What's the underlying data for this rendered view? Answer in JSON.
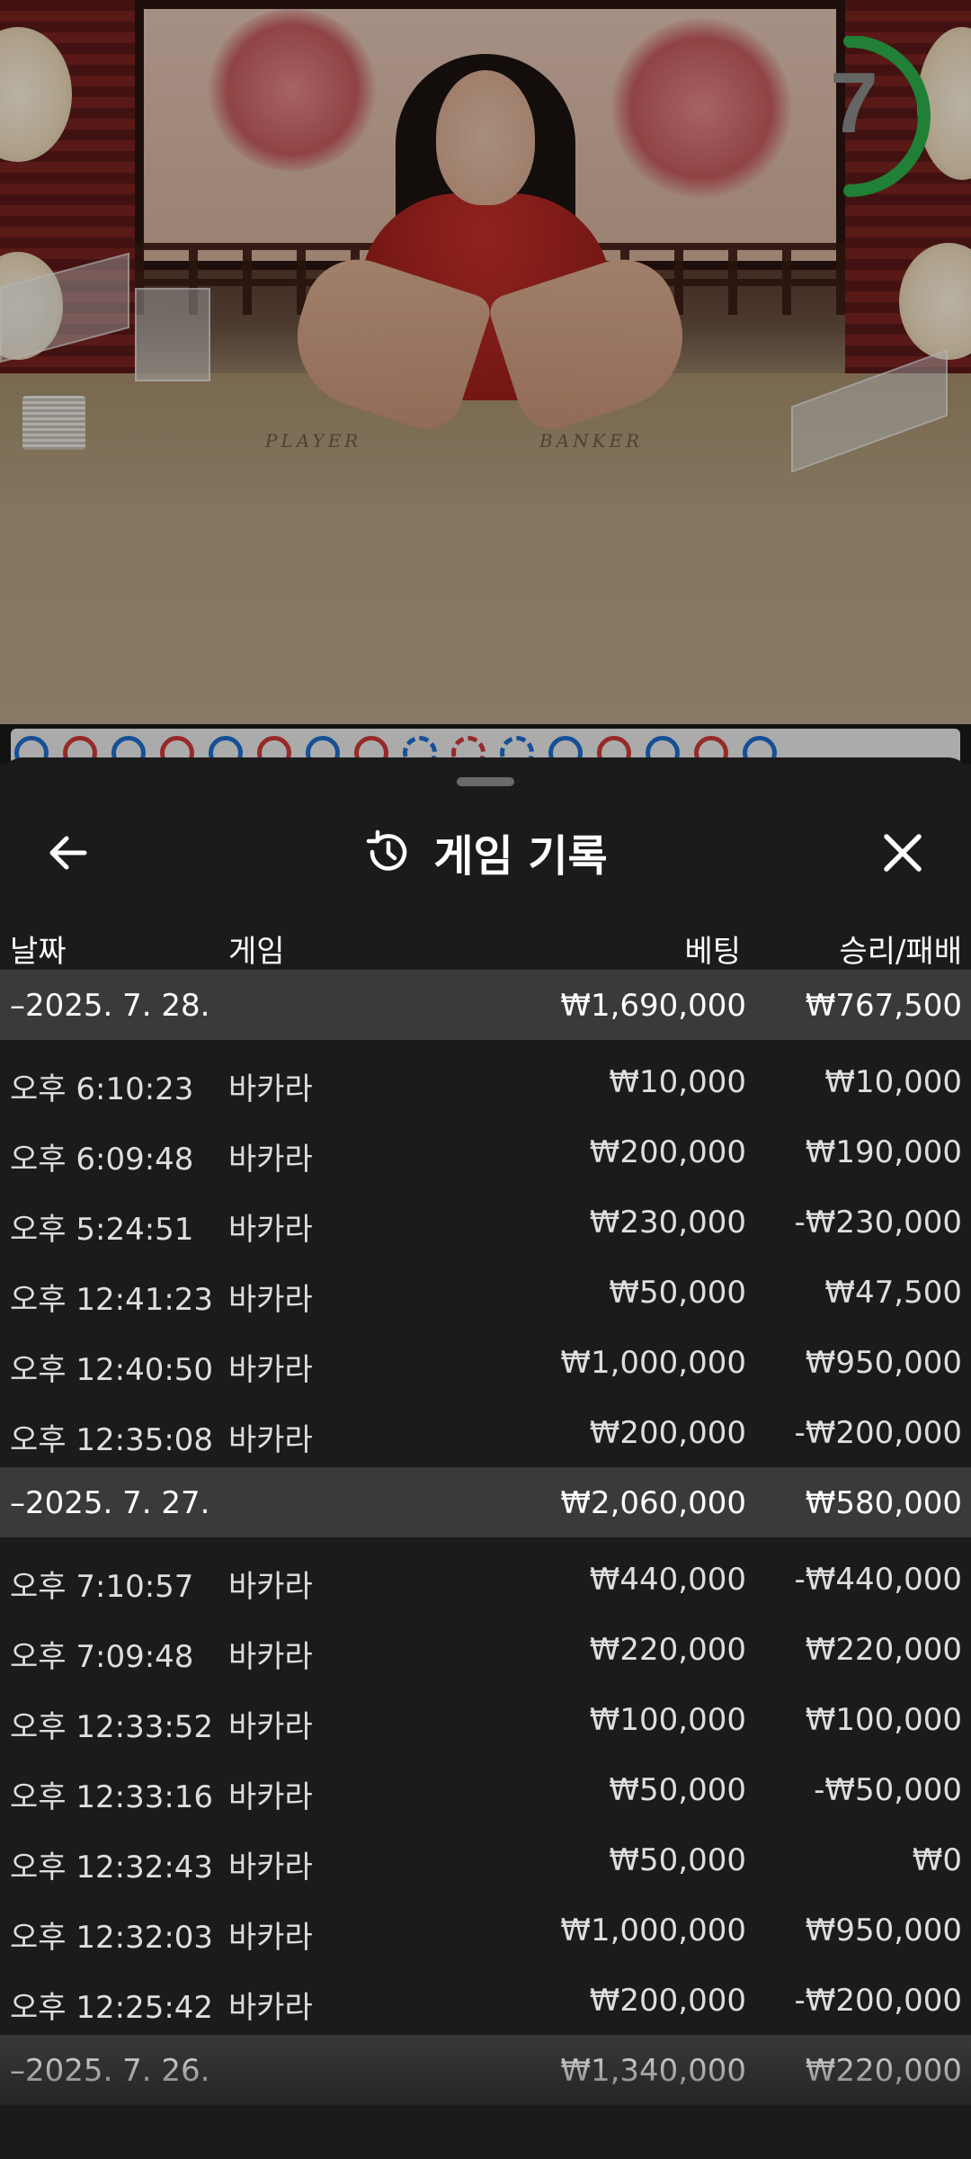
{
  "video": {
    "countdown": "7",
    "felt_player": "PLAYER",
    "felt_banker": "BANKER",
    "timer_color": "#2bb24c"
  },
  "sheet": {
    "title": "게임 기록",
    "columns": {
      "date": "날짜",
      "game": "게임",
      "bet": "베팅",
      "winloss": "승리/패배"
    }
  },
  "groups": [
    {
      "date": "–2025. 7. 28.",
      "bet": "₩1,690,000",
      "winloss": "₩767,500",
      "rows": [
        {
          "time": "오후 6:10:23",
          "game": "바카라",
          "bet": "₩10,000",
          "winloss": "₩10,000"
        },
        {
          "time": "오후 6:09:48",
          "game": "바카라",
          "bet": "₩200,000",
          "winloss": "₩190,000"
        },
        {
          "time": "오후 5:24:51",
          "game": "바카라",
          "bet": "₩230,000",
          "winloss": "-₩230,000"
        },
        {
          "time": "오후 12:41:23",
          "game": "바카라",
          "bet": "₩50,000",
          "winloss": "₩47,500"
        },
        {
          "time": "오후 12:40:50",
          "game": "바카라",
          "bet": "₩1,000,000",
          "winloss": "₩950,000"
        },
        {
          "time": "오후 12:35:08",
          "game": "바카라",
          "bet": "₩200,000",
          "winloss": "-₩200,000"
        }
      ]
    },
    {
      "date": "–2025. 7. 27.",
      "bet": "₩2,060,000",
      "winloss": "₩580,000",
      "rows": [
        {
          "time": "오후 7:10:57",
          "game": "바카라",
          "bet": "₩440,000",
          "winloss": "-₩440,000"
        },
        {
          "time": "오후 7:09:48",
          "game": "바카라",
          "bet": "₩220,000",
          "winloss": "₩220,000"
        },
        {
          "time": "오후 12:33:52",
          "game": "바카라",
          "bet": "₩100,000",
          "winloss": "₩100,000"
        },
        {
          "time": "오후 12:33:16",
          "game": "바카라",
          "bet": "₩50,000",
          "winloss": "-₩50,000"
        },
        {
          "time": "오후 12:32:43",
          "game": "바카라",
          "bet": "₩50,000",
          "winloss": "₩0"
        },
        {
          "time": "오후 12:32:03",
          "game": "바카라",
          "bet": "₩1,000,000",
          "winloss": "₩950,000"
        },
        {
          "time": "오후 12:25:42",
          "game": "바카라",
          "bet": "₩200,000",
          "winloss": "-₩200,000"
        }
      ]
    },
    {
      "date": "–2025. 7. 26.",
      "bet": "₩1,340,000",
      "winloss": "₩220,000",
      "rows": []
    }
  ],
  "icons": {
    "back": "arrow-left-icon",
    "history": "history-icon",
    "close": "close-icon"
  },
  "colors": {
    "sheet_bg": "#1b1b1b",
    "group_bg": "#3a3a3a",
    "road_blue": "#1e6fd0",
    "road_red": "#d23a3a"
  }
}
